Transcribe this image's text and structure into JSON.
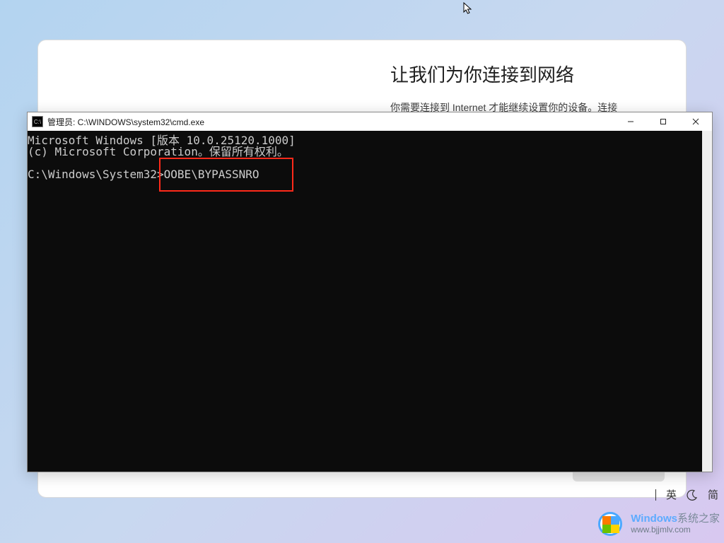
{
  "oobe": {
    "title": "让我们为你连接到网络",
    "subtitle": "你需要连接到 Internet 才能继续设置你的设备。连接"
  },
  "cmd": {
    "title": "管理员: C:\\WINDOWS\\system32\\cmd.exe",
    "line1": "Microsoft Windows [版本 10.0.25120.1000]",
    "line2": "(c) Microsoft Corporation。保留所有权利。",
    "prompt": "C:\\Windows\\System32>",
    "command": "OOBE\\BYPASSNRO",
    "controls": {
      "min": "—",
      "max": "□",
      "close": "✕"
    }
  },
  "ime": {
    "lang": "英",
    "mode": "简"
  },
  "watermark": {
    "brand_en": "Windows",
    "brand_cn": "系统之家",
    "url": "www.bjjmlv.com"
  },
  "cursor_glyph": "↖"
}
